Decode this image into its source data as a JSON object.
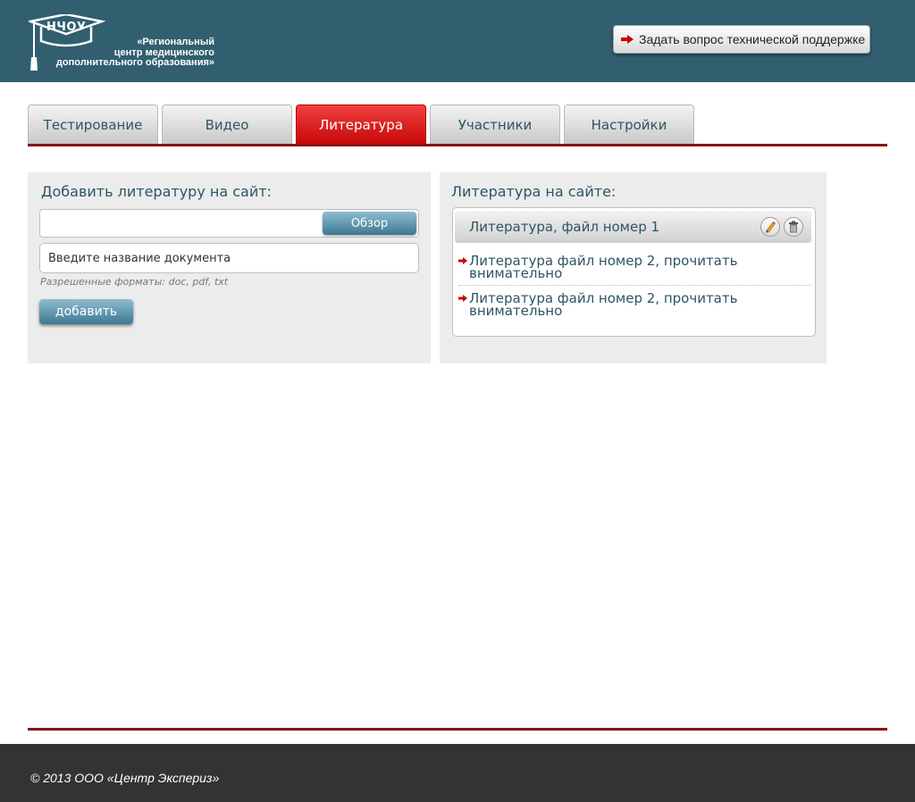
{
  "header": {
    "logo_abbr": "НЧОУ",
    "logo_line1": "«Региональный",
    "logo_line2": "центр медицинского",
    "logo_line3": "дополнительного образования»",
    "support_label": "Задать вопрос технической поддержке"
  },
  "tabs": [
    {
      "label": "Тестирование",
      "active": false
    },
    {
      "label": "Видео",
      "active": false
    },
    {
      "label": "Литература",
      "active": true
    },
    {
      "label": "Участники",
      "active": false
    },
    {
      "label": "Настройки",
      "active": false
    }
  ],
  "add_panel": {
    "title": "Добавить литературу на сайт:",
    "browse_label": "Обзор",
    "name_placeholder": "Введите название документа",
    "formats_note": "Разрешенные форматы: doc, pdf, txt",
    "add_label": "добавить"
  },
  "list_panel": {
    "title": "Литература на сайте:",
    "selected_item": "Литература, файл номер 1",
    "items": [
      {
        "line1": "Литература файл номер 2, прочитать",
        "line2": "внимательно"
      },
      {
        "line1": "Литература файл номер 2, прочитать",
        "line2": "внимательно"
      }
    ]
  },
  "footer": {
    "copyright": "© 2013 ООО «Центр Экспериз»"
  },
  "colors": {
    "header_bg": "#315f70",
    "accent_red": "#8b1414",
    "active_tab": "#d81010",
    "text_teal": "#2d5563",
    "footer_bg": "#333333"
  },
  "icons": {
    "logo": "graduation-cap-icon",
    "support_arrow": "arrow-right-icon",
    "edit": "pencil-icon",
    "delete": "trash-icon",
    "bullet": "arrow-right-icon"
  }
}
